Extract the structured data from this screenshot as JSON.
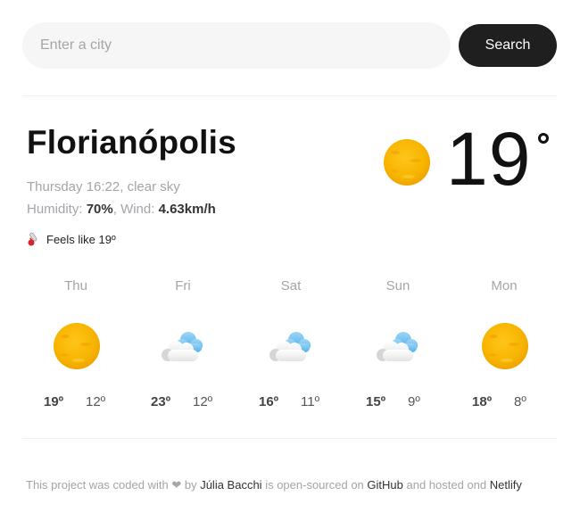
{
  "search": {
    "placeholder": "Enter a city",
    "button_label": "Search"
  },
  "current": {
    "city": "Florianópolis",
    "day_time_desc": "Thursday 16:22, clear sky",
    "humidity_label": "Humidity:",
    "humidity_value": "70%",
    "wind_label": "Wind:",
    "wind_value": "4.63km/h",
    "feels_like": "Feels like 19º",
    "temperature": "19",
    "icon": "sun-icon"
  },
  "forecast": [
    {
      "day": "Thu",
      "max": "19º",
      "min": "12º",
      "icon": "sun-icon"
    },
    {
      "day": "Fri",
      "max": "23º",
      "min": "12º",
      "icon": "cloud-icon"
    },
    {
      "day": "Sat",
      "max": "16º",
      "min": "11º",
      "icon": "cloud-icon"
    },
    {
      "day": "Sun",
      "max": "15º",
      "min": "9º",
      "icon": "cloud-icon"
    },
    {
      "day": "Mon",
      "max": "18º",
      "min": "8º",
      "icon": "sun-icon"
    }
  ],
  "footer": {
    "text1": "This project was coded with",
    "heart": "❤",
    "text2": "by",
    "author": "Júlia Bacchi",
    "text3": "is open-sourced on",
    "github": "GitHub",
    "text4": "and hosted ond",
    "netlify": "Netlify"
  },
  "colors": {
    "button_bg": "#1f1f1f",
    "input_bg": "#f6f6f7",
    "muted_text": "#a4a4ab",
    "sun_yellow": "#f7b500"
  }
}
